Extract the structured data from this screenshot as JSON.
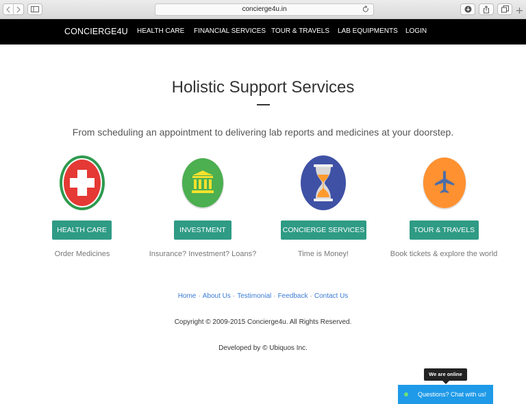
{
  "browser": {
    "url": "concierge4u.in",
    "icons": [
      "back-icon",
      "forward-icon",
      "sidebar-icon",
      "reload-icon",
      "download-icon",
      "share-icon",
      "tabs-icon",
      "new-tab-icon"
    ]
  },
  "navbar": {
    "brand": "CONCIERGE4U",
    "links": [
      "HEALTH CARE",
      "FINANCIAL SERVICES",
      "TOUR & TRAVELS",
      "LAB EQUIPMENTS",
      "LOGIN"
    ]
  },
  "main": {
    "title": "Holistic Support Services",
    "subtitle": "From scheduling an appointment to delivering lab reports and medicines at your doorstep.",
    "services": [
      {
        "button": "HEALTH CARE",
        "caption": "Order Medicines",
        "icon": "medical-cross-icon",
        "color": "#e53935"
      },
      {
        "button": "INVESTMENT",
        "caption": "Insurance? Investment? Loans?",
        "icon": "bank-icon",
        "color": "#4caf50"
      },
      {
        "button": "CONCIERGE SERVICES",
        "caption": "Time is Money!",
        "icon": "hourglass-icon",
        "color": "#3f51a5"
      },
      {
        "button": "TOUR & TRAVELS",
        "caption": "Book tickets & explore the world",
        "icon": "airplane-icon",
        "color": "#ff9130"
      }
    ],
    "button_color": "#2f9b85"
  },
  "footer": {
    "links": [
      "Home",
      "About Us",
      "Testimonial",
      "Feedback",
      "Contact Us"
    ],
    "separator": "·",
    "copyright": "Copyright © 2009-2015 Concierge4u. All Rights Reserved.",
    "developed_by": "Developed by © Ubiquos Inc."
  },
  "chat": {
    "status": "We are online",
    "label": "Questions? Chat with us!"
  }
}
